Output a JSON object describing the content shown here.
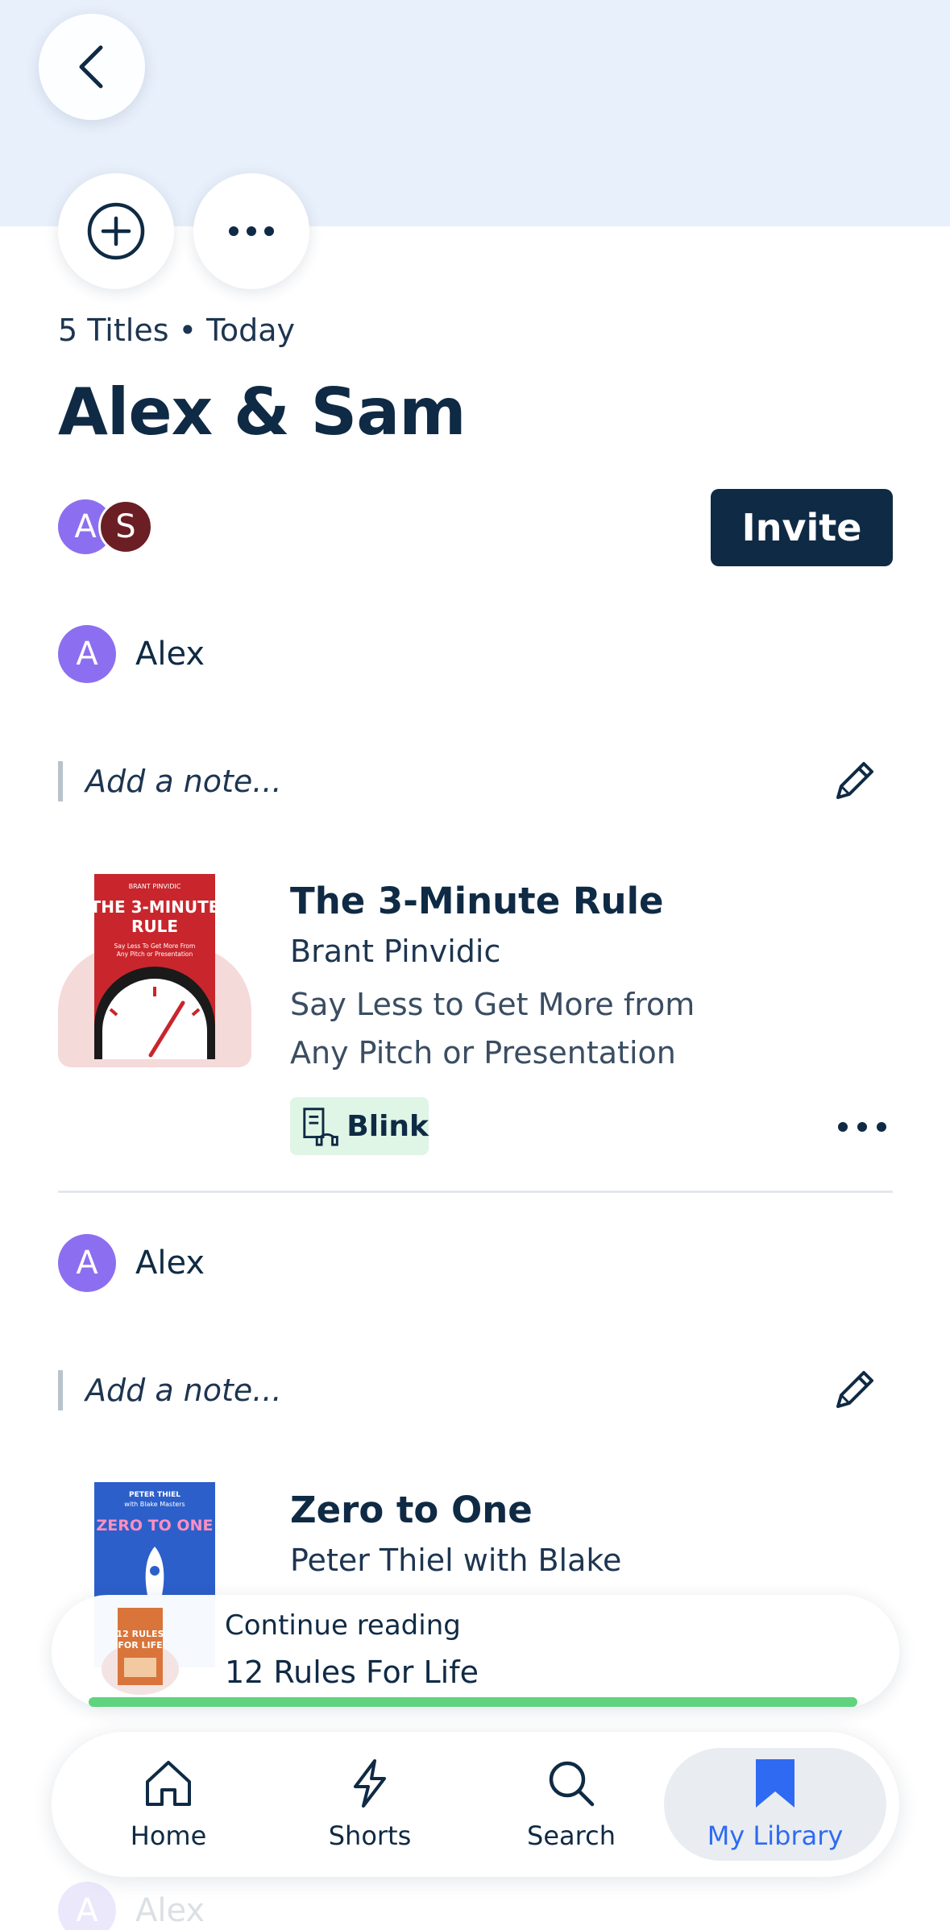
{
  "header": {
    "meta": "5 Titles • Today",
    "title": "Alex & Sam",
    "invite_label": "Invite",
    "members": [
      "A",
      "S"
    ]
  },
  "entries": [
    {
      "user_initial": "A",
      "user_name": "Alex",
      "note_placeholder": "Add a note...",
      "book": {
        "title": "The 3-Minute Rule",
        "author": "Brant Pinvidic",
        "desc_line1": "Say Less to Get More from",
        "desc_line2": "Any Pitch or Presentation",
        "badge": "Blink",
        "cover": {
          "top_text": "BRANT PINVIDIC",
          "title_line1": "THE 3-MINUTE",
          "title_line2": "RULE",
          "subtitle_line1": "Say Less To Get More From",
          "subtitle_line2": "Any Pitch or Presentation",
          "color": "#c8262c"
        }
      }
    },
    {
      "user_initial": "A",
      "user_name": "Alex",
      "note_placeholder": "Add a note...",
      "book": {
        "title": "Zero to One",
        "author": "Peter Thiel with Blake",
        "cover": {
          "top_text": "PETER THIEL",
          "top_text2": "with Blake Masters",
          "title": "ZERO TO ONE",
          "color": "#2c5fc9"
        }
      }
    }
  ],
  "continue_reading": {
    "label": "Continue reading",
    "title": "12 Rules For Life",
    "progress": 1.0,
    "cover_text_line1": "12 RULES",
    "cover_text_line2": "FOR LIFE"
  },
  "nav": {
    "items": [
      {
        "label": "Home",
        "icon": "home-icon"
      },
      {
        "label": "Shorts",
        "icon": "lightning-icon"
      },
      {
        "label": "Search",
        "icon": "search-icon"
      },
      {
        "label": "My Library",
        "icon": "bookmark-icon",
        "active": true
      }
    ],
    "active_color": "#2f6bf2"
  },
  "faded_next": {
    "user_initial": "A",
    "user_name": "Alex"
  }
}
